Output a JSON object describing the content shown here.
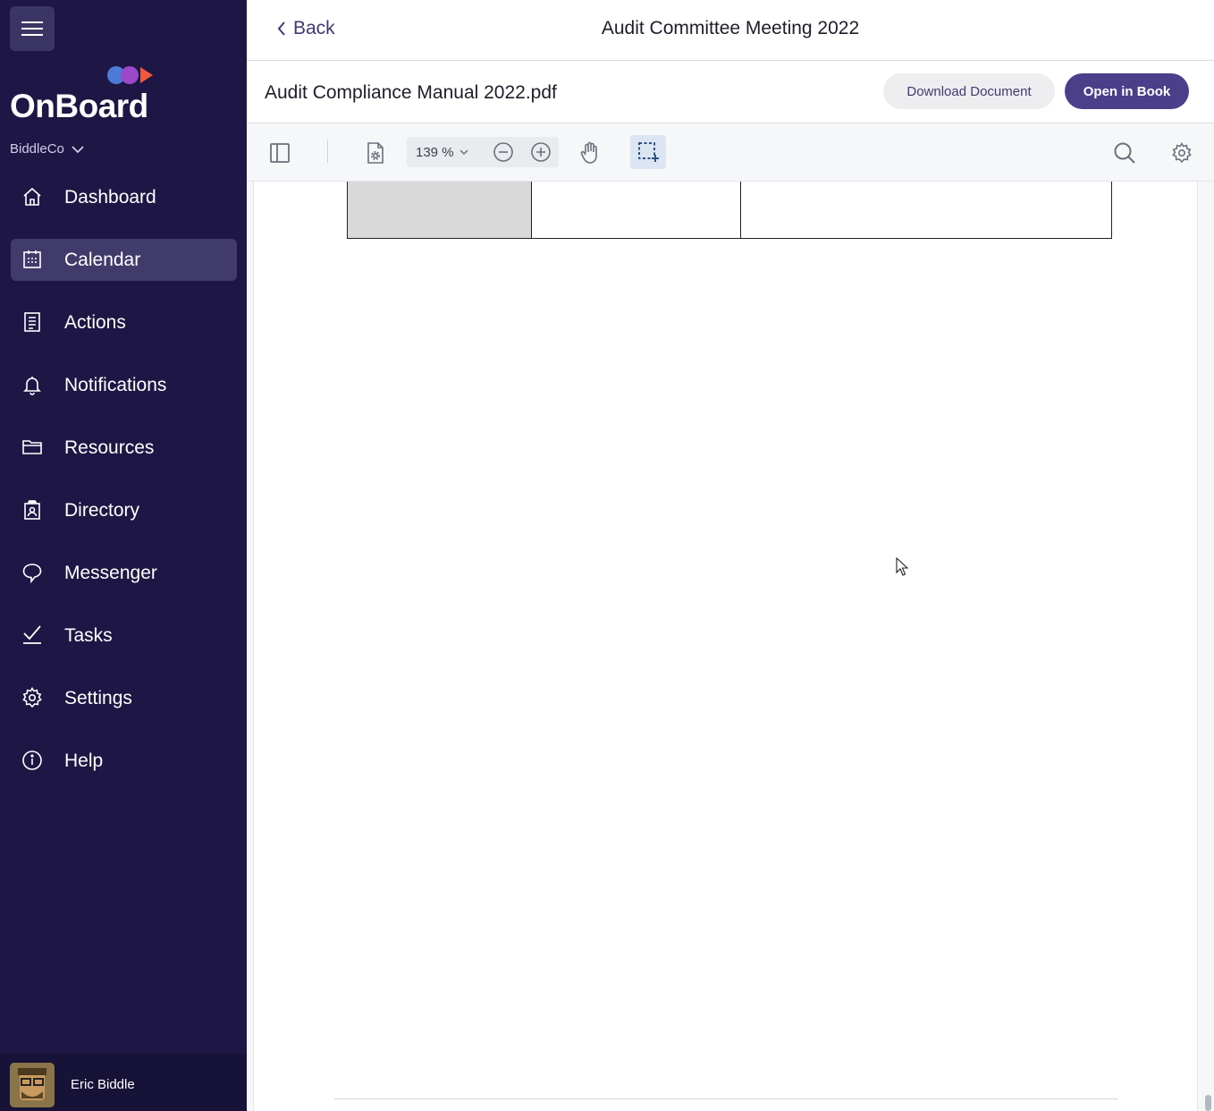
{
  "sidebar": {
    "brand": "OnBoard",
    "org": "BiddleCo",
    "items": [
      {
        "label": "Dashboard",
        "icon": "home-icon",
        "active": false
      },
      {
        "label": "Calendar",
        "icon": "calendar-icon",
        "active": true
      },
      {
        "label": "Actions",
        "icon": "list-icon",
        "active": false
      },
      {
        "label": "Notifications",
        "icon": "bell-icon",
        "active": false
      },
      {
        "label": "Resources",
        "icon": "folder-icon",
        "active": false
      },
      {
        "label": "Directory",
        "icon": "contacts-icon",
        "active": false
      },
      {
        "label": "Messenger",
        "icon": "chat-icon",
        "active": false
      },
      {
        "label": "Tasks",
        "icon": "check-icon",
        "active": false
      },
      {
        "label": "Settings",
        "icon": "gear-icon",
        "active": false
      },
      {
        "label": "Help",
        "icon": "info-icon",
        "active": false
      }
    ],
    "user": {
      "name": "Eric Biddle"
    }
  },
  "header": {
    "back_label": "Back",
    "title": "Audit Committee Meeting 2022"
  },
  "document": {
    "title": "Audit Compliance Manual 2022.pdf",
    "download_label": "Download Document",
    "open_label": "Open in Book"
  },
  "viewer": {
    "zoom": "139 %",
    "tools": [
      "sidebar-toggle-icon",
      "page-settings-icon",
      "zoom-out-icon",
      "zoom-in-icon",
      "pan-hand-icon",
      "area-select-icon",
      "search-icon",
      "gear-icon"
    ],
    "active_tool": "area-select-icon"
  },
  "colors": {
    "sidebar_bg": "#1e1745",
    "active_item_bg": "#413b6b",
    "primary": "#4b3f8a",
    "logo_blue": "#4a7bd6",
    "logo_purple": "#9b48c9",
    "logo_orange": "#f05a3a"
  }
}
